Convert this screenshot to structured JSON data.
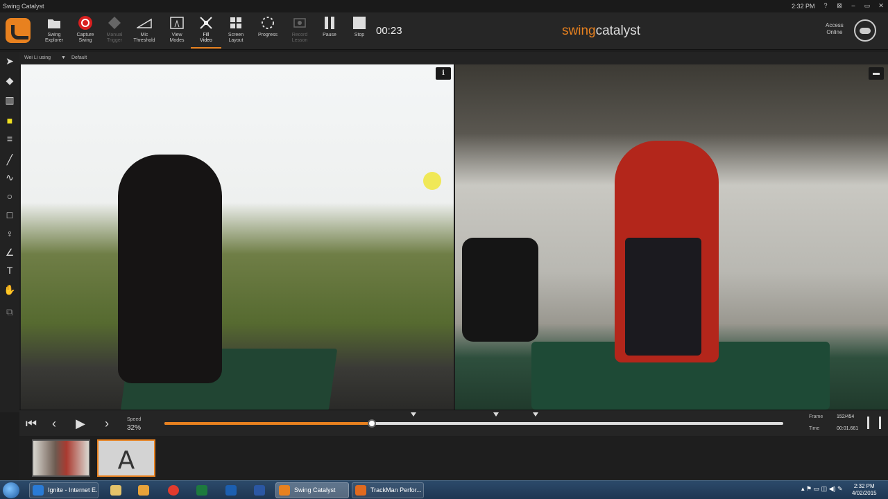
{
  "window": {
    "title": "Swing Catalyst",
    "clock": "2:32 PM",
    "controls": [
      "?",
      "⊠",
      "–",
      "▭",
      "✕"
    ]
  },
  "toolbar": {
    "buttons": [
      {
        "label": "Swing\nExplorer",
        "icon": "folder-icon"
      },
      {
        "label": "Capture\nSwing",
        "icon": "capture-icon"
      },
      {
        "label": "Manual\nTrigger",
        "icon": "trigger-icon"
      },
      {
        "label": "Mic\nThreshold",
        "icon": "mic-threshold-icon"
      },
      {
        "label": "View\nModes",
        "icon": "view-modes-icon"
      },
      {
        "label": "Fill\nVideo",
        "icon": "fill-video-icon"
      },
      {
        "label": "Screen\nLayout",
        "icon": "screen-layout-icon"
      },
      {
        "label": "Progress",
        "icon": "progress-icon"
      },
      {
        "label": "Record\nLesson",
        "icon": "record-lesson-icon"
      },
      {
        "label": "Pause",
        "icon": "pause-icon"
      },
      {
        "label": "Stop",
        "icon": "stop-icon"
      }
    ],
    "timer": "00:23",
    "brand_a": "swing",
    "brand_b": "catalyst",
    "access": "Access\nOnline"
  },
  "subbar": {
    "player": "Wei Li using",
    "profile": "Default"
  },
  "playback": {
    "speed_label": "Speed",
    "speed_value": "32%",
    "progress": 0.335,
    "markers": [
      0.402,
      0.536,
      0.6
    ],
    "frame_label": "Frame",
    "frame_value": "152/454",
    "time_label": "Time",
    "time_value": "00:01.661"
  },
  "thumbs": {
    "letter": "A"
  },
  "taskbar": {
    "items": [
      {
        "label": "Ignite - Internet E...",
        "color": "#2a7bd6"
      },
      {
        "label": "Swing Catalyst",
        "color": "#e8811f"
      },
      {
        "label": "TrackMan Perfor...",
        "color": "#e06a1f"
      }
    ],
    "pins": [
      "#e4c36a",
      "#e8a33a",
      "#e23b2e",
      "#1d7a3e",
      "#1c5fb0",
      "#2b57a3"
    ],
    "time": "2:32 PM",
    "date": "4/02/2015"
  },
  "colors": {
    "accent": "#e8811f"
  }
}
